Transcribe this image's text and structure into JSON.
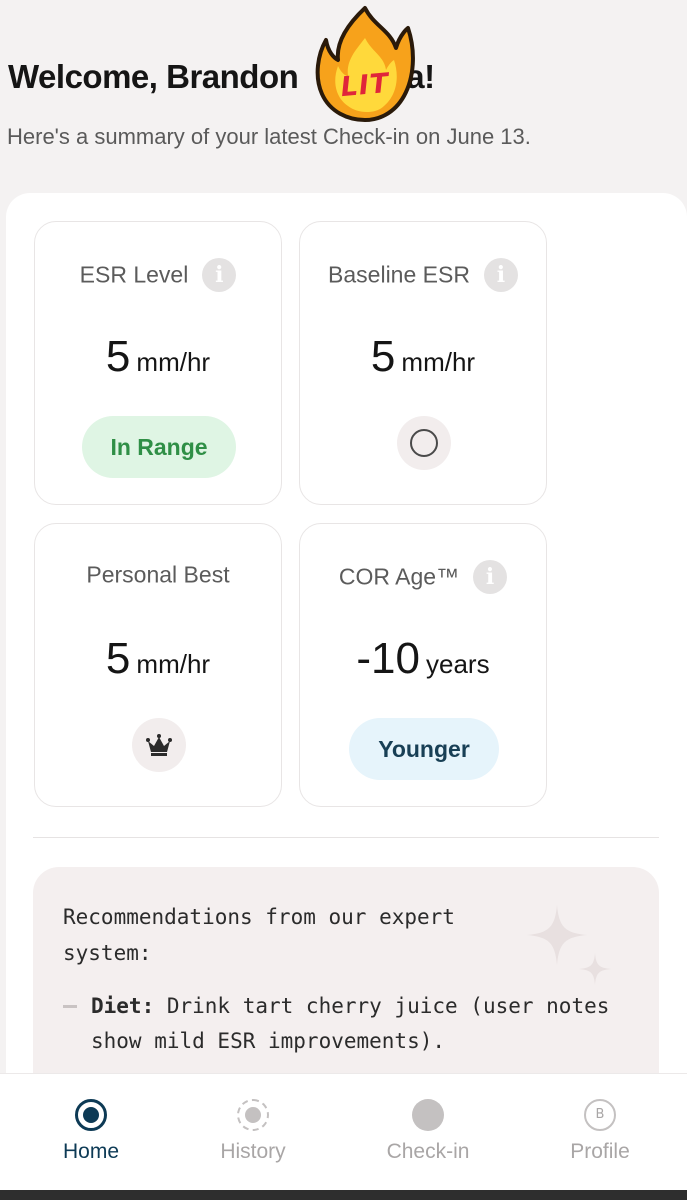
{
  "header": {
    "welcome_prefix": "Welcome, Brandon",
    "welcome_suffix": "a!",
    "sticker_text": "LIT",
    "subtitle": "Here's a summary of your latest Check-in on June 13."
  },
  "cards": {
    "esr_level": {
      "title": "ESR Level",
      "value": "5",
      "unit": "mm/hr",
      "status": "In Range"
    },
    "baseline_esr": {
      "title": "Baseline ESR",
      "value": "5",
      "unit": "mm/hr"
    },
    "personal_best": {
      "title": "Personal Best",
      "value": "5",
      "unit": "mm/hr"
    },
    "cor_age": {
      "title": "COR Age™",
      "value": "-10",
      "unit": "years",
      "status": "Younger"
    }
  },
  "recommendations": {
    "heading": "Recommendations from our expert system:",
    "items": [
      {
        "label": "Diet:",
        "text": " Drink tart cherry juice (user notes show mild ESR improvements)."
      }
    ]
  },
  "nav": {
    "items": [
      {
        "label": "Home",
        "active": true
      },
      {
        "label": "History",
        "active": false
      },
      {
        "label": "Check-in",
        "active": false
      },
      {
        "label": "Profile",
        "active": false,
        "icon_letter": "B"
      }
    ]
  },
  "colors": {
    "accent": "#0d3a55",
    "in_range_bg": "#dff5e4",
    "in_range_text": "#2f8f46",
    "younger_bg": "#e6f4fb",
    "recommendation_bg": "#f4efef"
  }
}
